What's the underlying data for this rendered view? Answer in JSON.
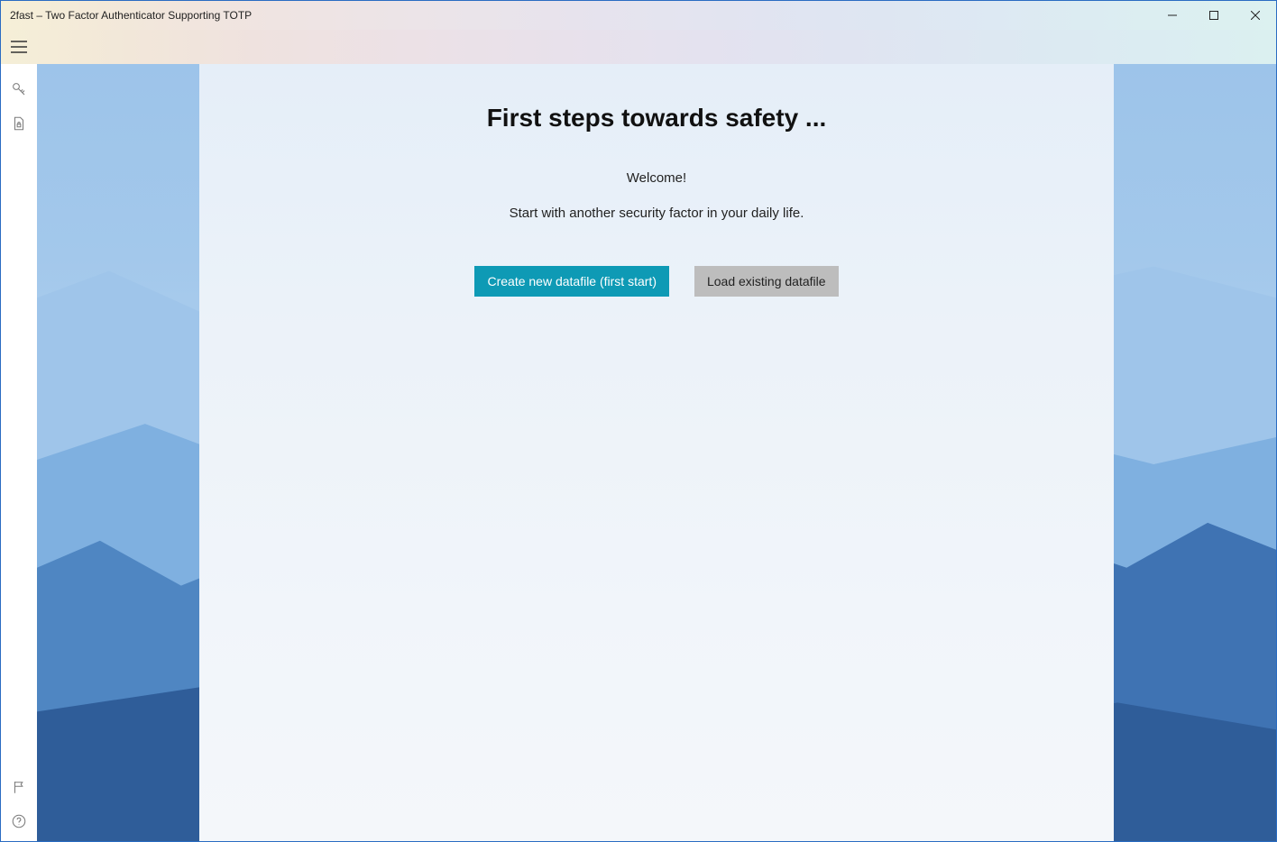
{
  "window": {
    "title": "2fast – Two Factor Authenticator Supporting TOTP"
  },
  "sidebar": {
    "icons": {
      "key": "key-icon",
      "file_lock": "file-lock-icon",
      "flag": "flag-icon",
      "help": "help-icon"
    }
  },
  "main": {
    "heading": "First steps towards safety ...",
    "welcome": "Welcome!",
    "tagline": "Start with another security factor in your daily life.",
    "buttons": {
      "create": "Create new datafile (first start)",
      "load": "Load existing datafile"
    }
  },
  "colors": {
    "accent": "#0e9ab5"
  }
}
